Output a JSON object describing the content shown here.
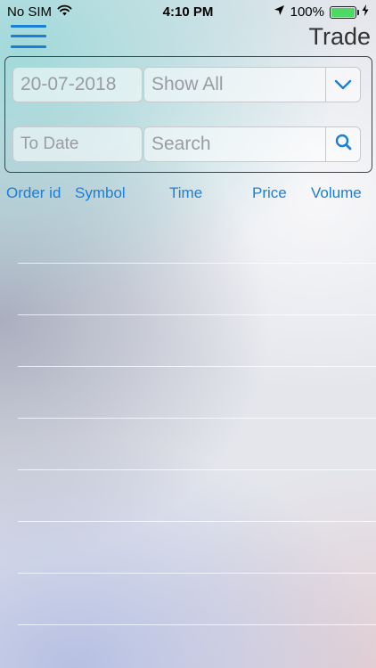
{
  "status_bar": {
    "carrier": "No SIM",
    "time": "4:10 PM",
    "battery_percent": "100%",
    "battery_level": 1.0,
    "battery_color": "#4cd964"
  },
  "nav": {
    "menu_icon": "hamburger-menu-icon",
    "title": "Trade"
  },
  "filters": {
    "from_date": "20-07-2018",
    "to_date_placeholder": "To Date",
    "status_selected": "Show All",
    "search_placeholder": "Search",
    "dropdown_icon": "chevron-down-icon",
    "search_icon": "search-icon"
  },
  "table": {
    "columns": [
      "Order id",
      "Symbol",
      "Time",
      "Price",
      "Volume"
    ],
    "rows": []
  },
  "colors": {
    "accent": "#1a7fd9"
  }
}
